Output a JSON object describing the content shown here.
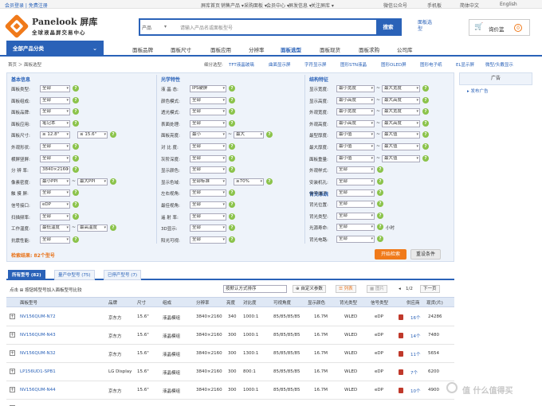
{
  "topbar": {
    "login": "会员登录 | 免费注册",
    "links": [
      "屏库首页",
      "销售产品 ▾",
      "采购面板 ▾",
      "会员中心 ▾",
      "screen"
    ],
    "nav": [
      "屏库首页",
      "销售产品 ▾",
      "采购面板 ▾",
      "会员中心 ▾",
      "屏发信息 ▾",
      "关注屏库 ▾",
      "微信公众号",
      "手机板",
      "简体中文",
      "English"
    ]
  },
  "header": {
    "logo_name": "Panelook 屏库",
    "logo_sub": "全球液晶屏交易中心",
    "search_category": "产品",
    "search_placeholder": "请输入产品名或面板型号",
    "search_button": "搜索",
    "panel_select": "面板选型",
    "cart_label": "询价篮",
    "cart_count": "0"
  },
  "navbar": {
    "all_categories": "全部产品分类",
    "items": [
      "面板品牌",
      "面板尺寸",
      "面板应用",
      "分辨率",
      "面板选型",
      "面板现货",
      "面板求购",
      "公司库"
    ],
    "active_index": 4
  },
  "breadcrumb": "首页 ＞ 面板选型",
  "quick_filters": {
    "label": "细分选型:",
    "items": [
      "TFT液晶玻璃",
      "曲面显示屏",
      "字符显示屏",
      "图形STN液晶",
      "图形OLED屏",
      "图形电子纸",
      "EL显示屏",
      "微型/头戴显示"
    ]
  },
  "filters": {
    "col1": {
      "title": "基本信息",
      "rows": [
        {
          "label": "面板类型:",
          "value": "全部"
        },
        {
          "label": "面板组成:",
          "value": "全部"
        },
        {
          "label": "面板品牌:",
          "value": "全部"
        },
        {
          "label": "面板应用:",
          "value": "笔记本"
        },
        {
          "label": "面板尺寸:",
          "value": "≥ 12.8\"",
          "value2": "≤ 15.6\""
        },
        {
          "label": "外观形状:",
          "value": "全部"
        },
        {
          "label": "横屏竖屏:",
          "value": "全部"
        },
        {
          "label": "分 辨 率:",
          "value": "3840×2160"
        },
        {
          "label": "像素密度:",
          "value": "最小PPI",
          "value2": "最大PPI"
        },
        {
          "label": "触 摸 屏:",
          "value": "全部"
        },
        {
          "label": "信号接口:",
          "value": "eDP"
        },
        {
          "label": "扫描频率:",
          "value": "全部"
        },
        {
          "label": "工作温度:",
          "value": "最低温度",
          "value2": "最高温度"
        },
        {
          "label": "抗震性能:",
          "value": "全部"
        }
      ]
    },
    "col2": {
      "title": "光学特性",
      "rows": [
        {
          "label": "液 晶 态:",
          "value": "IPS硬屏"
        },
        {
          "label": "颜色模式:",
          "value": "全部"
        },
        {
          "label": "透光模式:",
          "value": "全部"
        },
        {
          "label": "表面处理:",
          "value": "全部"
        },
        {
          "label": "面板亮度:",
          "value": "最小",
          "value2": "最大"
        },
        {
          "label": "对 比 度:",
          "value": "全部"
        },
        {
          "label": "灰阶深度:",
          "value": "全部"
        },
        {
          "label": "显示颜色:",
          "value": "全部"
        },
        {
          "label": "显示色域:",
          "value": "全部标准",
          "value2": "≥70%"
        },
        {
          "label": "左右视角:",
          "value": "全部"
        },
        {
          "label": "最佳视角:",
          "value": "全部"
        },
        {
          "label": "遥 射 率:",
          "value": "全部"
        },
        {
          "label": "3D显示:",
          "value": "全部"
        },
        {
          "label": "阳光可视:",
          "value": "全部"
        }
      ]
    },
    "col3": {
      "title": "结构特征",
      "rows": [
        {
          "label": "显示宽度:",
          "value": "最小宽度",
          "value2": "最大宽度"
        },
        {
          "label": "显示高度:",
          "value": "最小高度",
          "value2": "最大高度"
        },
        {
          "label": "外观宽度:",
          "value": "最小宽度",
          "value2": "最大宽度"
        },
        {
          "label": "外观高度:",
          "value": "最小高度",
          "value2": "最大高度"
        },
        {
          "label": "最型厚度:",
          "value": "最小值",
          "value2": "最大值"
        },
        {
          "label": "最大厚度:",
          "value": "最小值",
          "value2": "最大值"
        },
        {
          "label": "面板重量:",
          "value": "最小值",
          "value2": "最大值"
        },
        {
          "label": "外观样式:",
          "value": "全部"
        },
        {
          "label": "安装机孔:",
          "value": "全部"
        },
        {
          "label": "信号端子:",
          "value": "全部"
        }
      ],
      "title2": "背光系统",
      "rows2": [
        {
          "label": "背光位置:",
          "value": "全部"
        },
        {
          "label": "背光类型:",
          "value": "全部"
        },
        {
          "label": "光源寿命:",
          "value": "全部",
          "suffix": "小时"
        },
        {
          "label": "背光电路:",
          "value": "全部"
        }
      ]
    }
  },
  "ad": {
    "title": "广告",
    "link": "▸ 发布广告"
  },
  "result": {
    "text": "检索结果: 82个型号",
    "search_button": "开始检索",
    "reset_button": "重设条件"
  },
  "tabs": [
    "所有型号 (82)",
    "量产中型号 (75)",
    "已停产型号 (7)"
  ],
  "toolbar": {
    "hint": "点击 ⊞ 按钮将型号加入面板型号比较",
    "sort": "按默认方式排序",
    "custom": "⊕ 自定义参数",
    "list": "☰ 列表",
    "image": "▦ 图片",
    "page": "1/2",
    "next": "下一页"
  },
  "table": {
    "headers": [
      "面板型号",
      "品牌",
      "尺寸",
      "组成",
      "分辨率",
      "亮度",
      "对比度",
      "可视角度",
      "显示颜色",
      "背光类型",
      "信号类型",
      "",
      "供应商",
      "现货(片)"
    ],
    "rows": [
      [
        "NV156QUM-N72",
        "京东方",
        "15.6\"",
        "液晶模组",
        "3840×2160",
        "340",
        "1000:1",
        "85/85/85/85",
        "16.7M",
        "WLED",
        "eDP",
        "",
        "16个",
        "24286"
      ],
      [
        "NV156QUM-N43",
        "京东方",
        "15.6\"",
        "液晶模组",
        "3840×2160",
        "300",
        "1000:1",
        "85/85/85/85",
        "16.7M",
        "WLED",
        "eDP",
        "",
        "14个",
        "7480"
      ],
      [
        "NV156QUM-N32",
        "京东方",
        "15.6\"",
        "液晶模组",
        "3840×2160",
        "300",
        "1300:1",
        "85/85/85/85",
        "16.7M",
        "WLED",
        "eDP",
        "",
        "11个",
        "5654"
      ],
      [
        "LP156UD1-SPB1",
        "LG Display",
        "15.6\"",
        "液晶模组",
        "3840×2160",
        "300",
        "800:1",
        "85/85/85/85",
        "16.7M",
        "WLED",
        "eDP",
        "",
        "7个",
        "6200"
      ],
      [
        "NV156QUM-N44",
        "京东方",
        "15.6\"",
        "液晶模组",
        "3840×2160",
        "300",
        "1000:1",
        "85/85/85/85",
        "16.7M",
        "WLED",
        "eDP",
        "",
        "10个",
        "4900"
      ],
      [
        "NV140QUM-N61",
        "京东方",
        "14\"",
        "液晶模组",
        "3840×2160",
        "400",
        "800:1",
        "85/85/85/85",
        "16.7M",
        "WLED",
        "eDP",
        "",
        "8个",
        "6383"
      ]
    ]
  },
  "watermark": "值 什么值得买",
  "colors": {
    "brand_blue": "#2a62b8",
    "accent_orange": "#f07a1a",
    "help_green": "#8bc34a"
  }
}
